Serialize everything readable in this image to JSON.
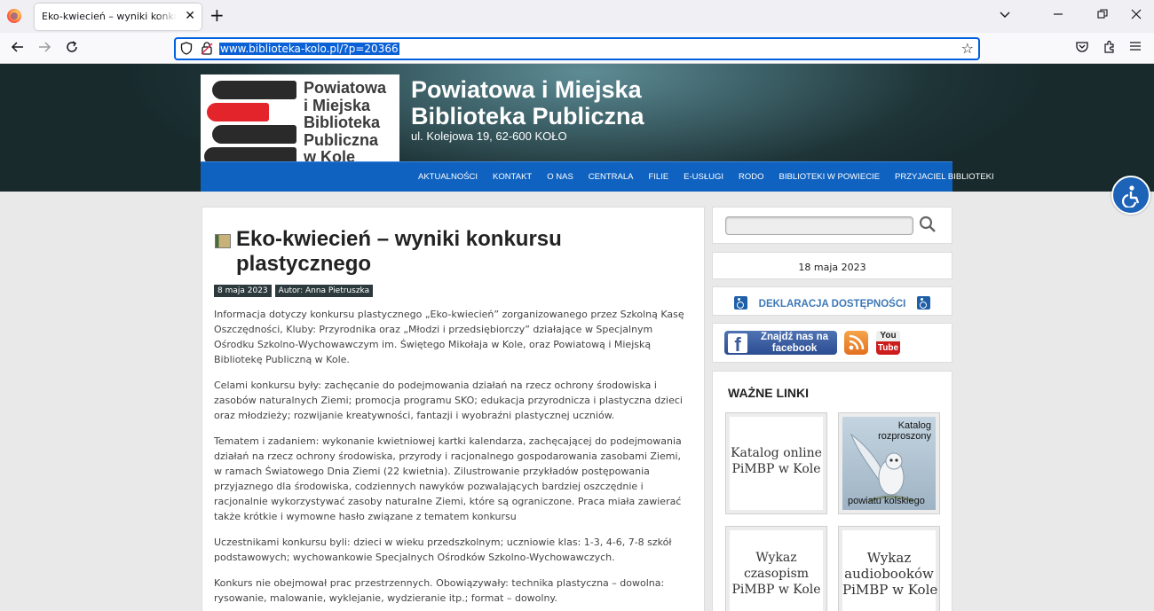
{
  "browser": {
    "tab_title": "Eko-kwiecień – wyniki konkursu plastycznego",
    "new_tab": "+",
    "url": "www.biblioteka-kolo.pl/?p=20366"
  },
  "header": {
    "logo_text": "Powiatowa\ni Miejska\nBiblioteka\nPubliczna\nw Kole",
    "site_title": "Powiatowa i Miejska\nBiblioteka Publiczna",
    "address": "ul. Kolejowa 19, 62-600 KOŁO",
    "menu": [
      "AKTUALNOŚCI",
      "KONTAKT",
      "O NAS",
      "CENTRALA",
      "FILIE",
      "E-USŁUGI",
      "RODO",
      "BIBLIOTEKI W POWIECIE",
      "PRZYJACIEL BIBLIOTEKI"
    ]
  },
  "article": {
    "title": "Eko-kwiecień – wyniki konkursu plastycznego",
    "date": "8 maja 2023",
    "author": "Autor: Anna Pietruszka",
    "paragraphs": [
      "Informacja dotyczy konkursu plastycznego „Eko-kwiecień” zorganizowanego przez  Szkolną Kasę Oszczędności, Kluby: Przyrodnika oraz „Młodzi i przedsiębiorczy” działające w  Specjalnym Ośrodku Szkolno-Wychowawczym im. Świętego Mikołaja  w Kole, oraz Powiatową i Miejską Bibliotekę Publiczną w Kole.",
      "Celami konkursu były:  zachęcanie do podejmowania działań na rzecz ochrony środowiska i zasobów naturalnych Ziemi; promocja programu SKO; edukacja przyrodnicza i plastyczna dzieci oraz  młodzieży; rozwijanie kreatywności, fantazji i wyobraźni plastycznej uczniów.",
      "Tematem i zadaniem:  wykonanie kwietniowej kartki kalendarza,  zachęcającej do podejmowania działań na rzecz ochrony środowiska, przyrody i racjonalnego gospodarowania zasobami Ziemi,  w ramach  Światowego Dnia Ziemi (22 kwietnia). Zilustrowanie przykładów postępowania przyjaznego dla środowiska, codziennych nawyków pozwalających bardziej oszczędnie i racjonalnie wykorzystywać zasoby naturalne Ziemi, które są  ograniczone.   Praca miała  zawierać także krótkie i wymowne hasło związane z tematem konkursu",
      "Uczestnikami konkursu byli:  dzieci w wieku przedszkolnym; uczniowie klas:  1-3,  4-6, 7-8 szkół podstawowych; wychowankowie Specjalnych Ośrodków Szkolno-Wychowawczych.",
      "Konkurs nie obejmował prac przestrzennych. Obowiązywały: technika plastyczna – dowolna: rysowanie, malowanie, wyklejanie, wydzieranie itp.; format – dowolny."
    ]
  },
  "sidebar": {
    "search_placeholder": "",
    "date": "18 maja 2023",
    "declaration": "DEKLARACJA DOSTĘPNOŚCI",
    "facebook": "Znajdź nas na\nfacebook",
    "youtube_top": "You",
    "youtube_bottom": "Tube",
    "links_title": "WAŻNE LINKI",
    "tiles": {
      "catalog_online": "Katalog online\nPiMBP w Kole",
      "catalog_scattered_top": "Katalog\nrozproszony",
      "catalog_scattered_bottom": "powiatu kolskiego",
      "magazines": "Wykaz\nczasopism\nPiMBP w Kole",
      "audiobooks": "Wykaz\naudiobooków\nPiMBP w Kole"
    }
  },
  "colors": {
    "menu_bg": "#0f62c0",
    "header_dark": "#1e3437",
    "accent_blue": "#3d79b8",
    "url_highlight": "#0a61d6"
  }
}
